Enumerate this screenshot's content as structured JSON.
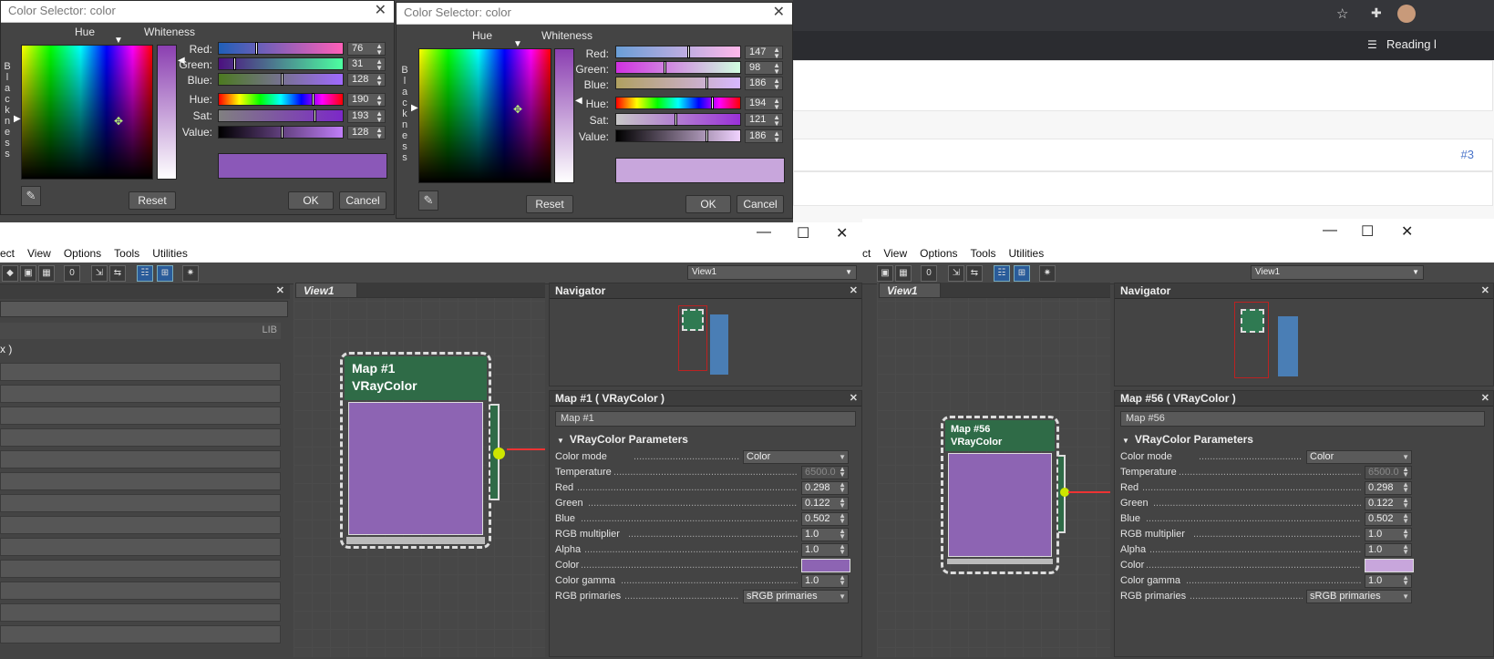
{
  "browser": {
    "reading_list": "Reading l",
    "item_label": "#3",
    "colors": {
      "accent": "#4a74c9",
      "page_bg": "#f7f7f7",
      "bar_bg": "#2b2c30"
    }
  },
  "color_selector_1": {
    "title": "Color Selector: color",
    "hue_label": "Hue",
    "whiteness_label": "Whiteness",
    "blackness_letters": [
      "B",
      "l",
      "a",
      "c",
      "k",
      "n",
      "e",
      "s",
      "s"
    ],
    "sliders": [
      {
        "label": "Red:",
        "value": "76"
      },
      {
        "label": "Green:",
        "value": "31"
      },
      {
        "label": "Blue:",
        "value": "128"
      },
      {
        "label": "Hue:",
        "value": "190"
      },
      {
        "label": "Sat:",
        "value": "193"
      },
      {
        "label": "Value:",
        "value": "128"
      }
    ],
    "preview_color": "#8b58b8",
    "reset_label": "Reset",
    "ok_label": "OK",
    "cancel_label": "Cancel"
  },
  "color_selector_2": {
    "title": "Color Selector: color",
    "hue_label": "Hue",
    "whiteness_label": "Whiteness",
    "blackness_letters": [
      "B",
      "l",
      "a",
      "c",
      "k",
      "n",
      "e",
      "s",
      "s"
    ],
    "sliders": [
      {
        "label": "Red:",
        "value": "147"
      },
      {
        "label": "Green:",
        "value": "98"
      },
      {
        "label": "Blue:",
        "value": "186"
      },
      {
        "label": "Hue:",
        "value": "194"
      },
      {
        "label": "Sat:",
        "value": "121"
      },
      {
        "label": "Value:",
        "value": "186"
      }
    ],
    "preview_color": "#c8a6dc",
    "reset_label": "Reset",
    "ok_label": "OK",
    "cancel_label": "Cancel"
  },
  "slate_1": {
    "menu": [
      "ect",
      "View",
      "Options",
      "Tools",
      "Utilities"
    ],
    "view_select": "View1",
    "view_tab": "View1",
    "left_panel": {
      "lib_label": "LIB",
      "row_text": "x )"
    },
    "navigator_title": "Navigator",
    "node": {
      "title": "Map #1",
      "type": "VRayColor",
      "swatch": "#8d64b3"
    },
    "param_panel": {
      "header": "Map #1  ( VRayColor )",
      "name_field": "Map #1",
      "rollout": "VRayColor Parameters",
      "params": [
        {
          "name": "Color mode",
          "value": "Color",
          "kind": "dropdown"
        },
        {
          "name": "Temperature",
          "value": "6500.0",
          "kind": "disabled"
        },
        {
          "name": "Red",
          "value": "0.298",
          "kind": "spin"
        },
        {
          "name": "Green",
          "value": "0.122",
          "kind": "spin"
        },
        {
          "name": "Blue",
          "value": "0.502",
          "kind": "spin"
        },
        {
          "name": "RGB multiplier",
          "value": "1.0",
          "kind": "spin"
        },
        {
          "name": "Alpha",
          "value": "1.0",
          "kind": "spin"
        },
        {
          "name": "Color",
          "value": "",
          "kind": "swatch",
          "color": "#8d64b3"
        },
        {
          "name": "Color gamma",
          "value": "1.0",
          "kind": "spin"
        },
        {
          "name": "RGB primaries",
          "value": "sRGB primaries",
          "kind": "dropdown"
        }
      ]
    }
  },
  "slate_2": {
    "menu": [
      "ct",
      "View",
      "Options",
      "Tools",
      "Utilities"
    ],
    "view_select": "View1",
    "view_tab": "View1",
    "navigator_title": "Navigator",
    "node": {
      "title": "Map #56",
      "type": "VRayColor",
      "swatch": "#8d64b3"
    },
    "param_panel": {
      "header": "Map #56  ( VRayColor )",
      "name_field": "Map #56",
      "rollout": "VRayColor Parameters",
      "params": [
        {
          "name": "Color mode",
          "value": "Color",
          "kind": "dropdown"
        },
        {
          "name": "Temperature",
          "value": "6500.0",
          "kind": "disabled"
        },
        {
          "name": "Red",
          "value": "0.298",
          "kind": "spin"
        },
        {
          "name": "Green",
          "value": "0.122",
          "kind": "spin"
        },
        {
          "name": "Blue",
          "value": "0.502",
          "kind": "spin"
        },
        {
          "name": "RGB multiplier",
          "value": "1.0",
          "kind": "spin"
        },
        {
          "name": "Alpha",
          "value": "1.0",
          "kind": "spin"
        },
        {
          "name": "Color",
          "value": "",
          "kind": "swatch",
          "color": "#c8a6dc"
        },
        {
          "name": "Color gamma",
          "value": "1.0",
          "kind": "spin"
        },
        {
          "name": "RGB primaries",
          "value": "sRGB primaries",
          "kind": "dropdown"
        }
      ]
    }
  }
}
